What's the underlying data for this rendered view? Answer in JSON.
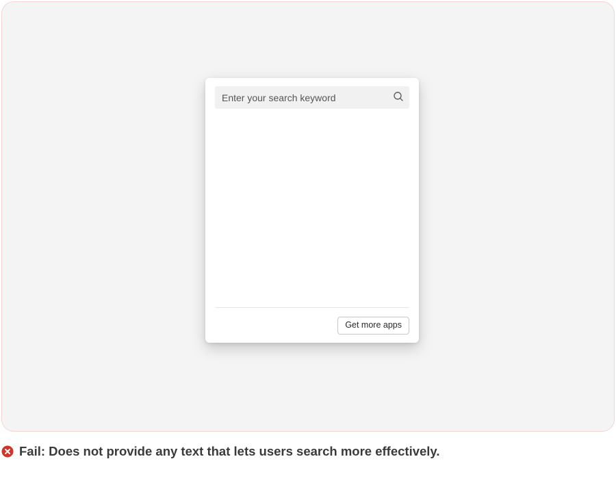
{
  "popup": {
    "search": {
      "placeholder": "Enter your search keyword",
      "value": ""
    },
    "footer": {
      "get_more_label": "Get more apps"
    }
  },
  "caption": {
    "status_label": "Fail:",
    "message": "Does not provide any text that lets users search more effectively."
  },
  "colors": {
    "frame_bg": "#f4f4f4",
    "frame_border": "#f6d3d5",
    "fail_icon": "#d23428"
  }
}
